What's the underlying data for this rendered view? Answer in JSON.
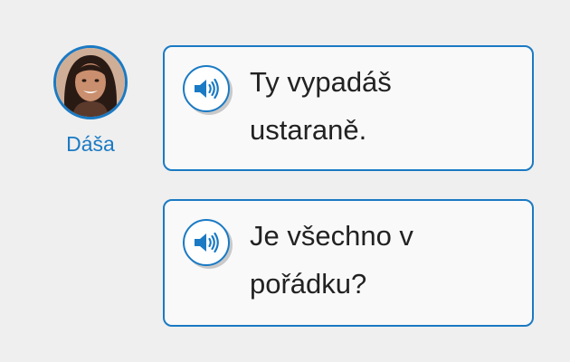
{
  "speaker": {
    "name": "Dáša",
    "avatar_icon": "woman-portrait-avatar"
  },
  "messages": [
    {
      "text": "Ty vypadáš ustaraně.",
      "audio_icon": "speaker-icon"
    },
    {
      "text": "Je všechno v pořádku?",
      "audio_icon": "speaker-icon"
    }
  ],
  "colors": {
    "accent": "#1a7ac4",
    "background": "#efefef",
    "bubble": "#f9f9f9",
    "text": "#222222"
  }
}
